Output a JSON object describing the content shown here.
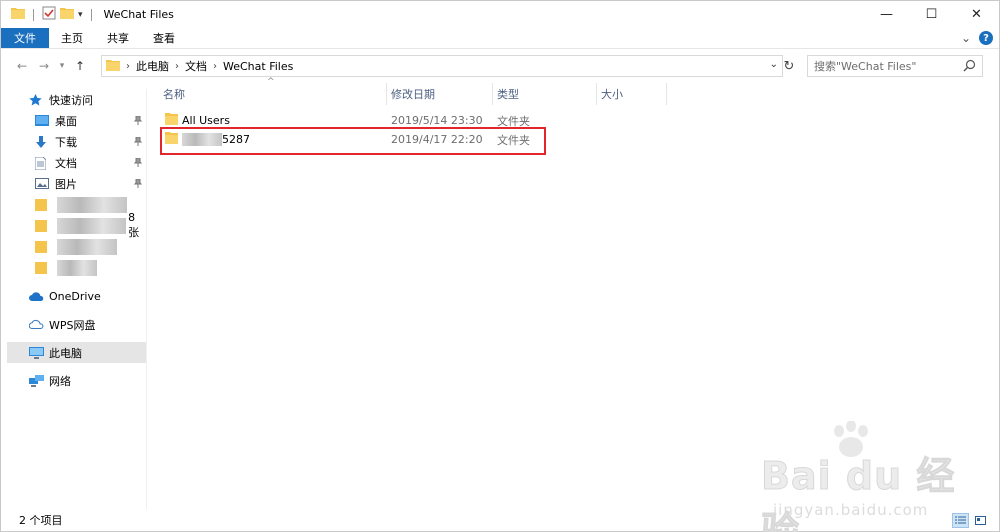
{
  "window": {
    "title": "WeChat Files",
    "controls": {
      "minimize": "—",
      "maximize": "☐",
      "close": "✕"
    }
  },
  "ribbon": {
    "tabs": [
      "文件",
      "主页",
      "共享",
      "查看"
    ],
    "expand": "⌄",
    "help": "?"
  },
  "address": {
    "crumbs": [
      "此电脑",
      "文档",
      "WeChat Files"
    ],
    "search_placeholder": "搜索\"WeChat Files\""
  },
  "nav": {
    "quick_access": "快速访问",
    "items": [
      {
        "label": "桌面",
        "pinned": true
      },
      {
        "label": "下载",
        "pinned": true
      },
      {
        "label": "文档",
        "pinned": true
      },
      {
        "label": "图片",
        "pinned": true
      }
    ],
    "blurred_suffix": "8张",
    "onedrive": "OneDrive",
    "wps": "WPS网盘",
    "this_pc": "此电脑",
    "network": "网络"
  },
  "columns": {
    "name": "名称",
    "date": "修改日期",
    "type": "类型",
    "size": "大小"
  },
  "files": [
    {
      "name": "All Users",
      "date": "2019/5/14 23:30",
      "type": "文件夹"
    },
    {
      "name": "5287",
      "date": "2019/4/17 22:20",
      "type": "文件夹"
    }
  ],
  "status": {
    "count": "2 个项目"
  },
  "watermark": {
    "brand": "Bai du 经验",
    "url": "jingyan.baidu.com"
  },
  "colors": {
    "accent": "#1a6fbe",
    "highlight": "#e3262b",
    "folder": "#f5c44d"
  }
}
